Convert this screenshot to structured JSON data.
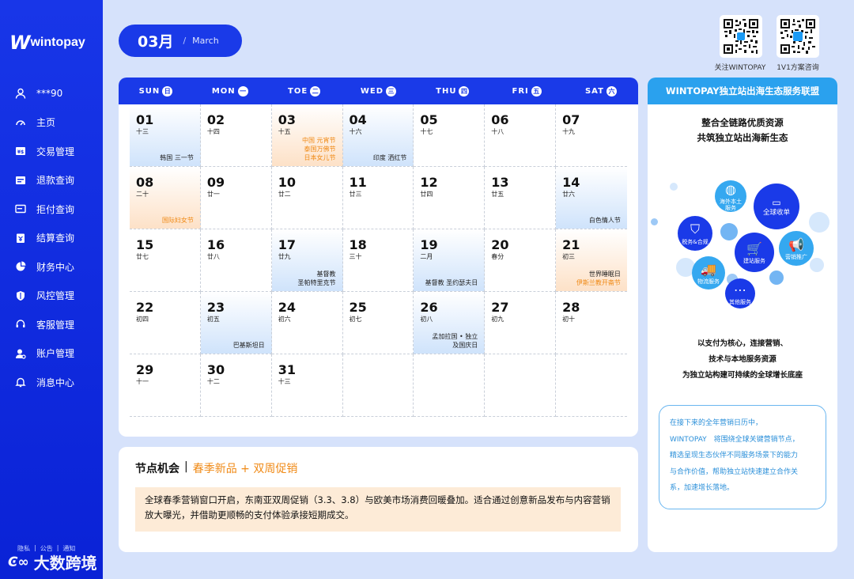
{
  "sidebar": {
    "logo_mark": "W",
    "logo_text": "wintopay",
    "user": "***90",
    "items": [
      {
        "label": "主页",
        "icon": "dashboard-icon"
      },
      {
        "label": "交易管理",
        "icon": "transaction-icon"
      },
      {
        "label": "退款查询",
        "icon": "refund-icon"
      },
      {
        "label": "拒付查询",
        "icon": "chargeback-icon"
      },
      {
        "label": "结算查询",
        "icon": "settlement-icon"
      },
      {
        "label": "财务中心",
        "icon": "pie-chart-icon"
      },
      {
        "label": "风控管理",
        "icon": "shield-icon"
      },
      {
        "label": "客服管理",
        "icon": "headset-icon"
      },
      {
        "label": "账户管理",
        "icon": "user-settings-icon"
      },
      {
        "label": "消息中心",
        "icon": "bell-icon"
      }
    ],
    "footer_links": [
      "隐私",
      "|",
      "公告",
      "|",
      "通知"
    ]
  },
  "watermark": {
    "mark": "Ͼ∞",
    "text": "大数跨境"
  },
  "header": {
    "month_num": "03月",
    "month_sep": "/",
    "month_en": "March",
    "qr_codes": [
      {
        "caption": "关注WINTOPAY"
      },
      {
        "caption": "1V1方案咨询"
      }
    ]
  },
  "calendar": {
    "weekdays": [
      {
        "label": "SUN",
        "badge": "日"
      },
      {
        "label": "MON",
        "badge": "一"
      },
      {
        "label": "TOE",
        "badge": "二"
      },
      {
        "label": "WED",
        "badge": "三"
      },
      {
        "label": "THU",
        "badge": "四"
      },
      {
        "label": "FRI",
        "badge": "五"
      },
      {
        "label": "SAT",
        "badge": "六"
      }
    ],
    "days": [
      {
        "day": "01",
        "lunar": "十三",
        "fest": "韩国 三一节",
        "style": "blue",
        "fest_color": "dark"
      },
      {
        "day": "02",
        "lunar": "十四",
        "fest": "",
        "style": "white",
        "fest_color": "dark"
      },
      {
        "day": "03",
        "lunar": "十五",
        "fest": "中国 元宵节\n泰国万佛节\n日本女儿节",
        "style": "orange",
        "fest_color": "orange"
      },
      {
        "day": "04",
        "lunar": "十六",
        "fest": "印度 洒红节",
        "style": "blue",
        "fest_color": "dark"
      },
      {
        "day": "05",
        "lunar": "十七",
        "fest": "",
        "style": "white",
        "fest_color": "dark"
      },
      {
        "day": "06",
        "lunar": "十八",
        "fest": "",
        "style": "white",
        "fest_color": "dark"
      },
      {
        "day": "07",
        "lunar": "十九",
        "fest": "",
        "style": "white",
        "fest_color": "dark"
      },
      {
        "day": "08",
        "lunar": "二十",
        "fest": "国际妇女节",
        "style": "orange",
        "fest_color": "orange"
      },
      {
        "day": "09",
        "lunar": "廿一",
        "fest": "",
        "style": "white",
        "fest_color": "dark"
      },
      {
        "day": "10",
        "lunar": "廿二",
        "fest": "",
        "style": "white",
        "fest_color": "dark"
      },
      {
        "day": "11",
        "lunar": "廿三",
        "fest": "",
        "style": "white",
        "fest_color": "dark"
      },
      {
        "day": "12",
        "lunar": "廿四",
        "fest": "",
        "style": "white",
        "fest_color": "dark"
      },
      {
        "day": "13",
        "lunar": "廿五",
        "fest": "",
        "style": "white",
        "fest_color": "dark"
      },
      {
        "day": "14",
        "lunar": "廿六",
        "fest": "白色情人节",
        "style": "blue",
        "fest_color": "dark"
      },
      {
        "day": "15",
        "lunar": "廿七",
        "fest": "",
        "style": "white",
        "fest_color": "dark"
      },
      {
        "day": "16",
        "lunar": "廿八",
        "fest": "",
        "style": "white",
        "fest_color": "dark"
      },
      {
        "day": "17",
        "lunar": "廿九",
        "fest": "基督教\n圣帕特里克节",
        "style": "blue",
        "fest_color": "dark"
      },
      {
        "day": "18",
        "lunar": "三十",
        "fest": "",
        "style": "white",
        "fest_color": "dark"
      },
      {
        "day": "19",
        "lunar": "二月",
        "fest": "基督教 圣约瑟夫日",
        "style": "blue",
        "fest_color": "dark"
      },
      {
        "day": "20",
        "lunar": "春分",
        "fest": "",
        "style": "white",
        "fest_color": "dark"
      },
      {
        "day": "21",
        "lunar": "初三",
        "fest": "世界睡眠日\n伊斯兰教开斋节",
        "style": "orange",
        "fest_color": "mixed"
      },
      {
        "day": "22",
        "lunar": "初四",
        "fest": "",
        "style": "white",
        "fest_color": "dark"
      },
      {
        "day": "23",
        "lunar": "初五",
        "fest": "巴基斯坦日",
        "style": "blue",
        "fest_color": "dark"
      },
      {
        "day": "24",
        "lunar": "初六",
        "fest": "",
        "style": "white",
        "fest_color": "dark"
      },
      {
        "day": "25",
        "lunar": "初七",
        "fest": "",
        "style": "white",
        "fest_color": "dark"
      },
      {
        "day": "26",
        "lunar": "初八",
        "fest": "孟加拉国 • 独立\n及国庆日",
        "style": "blue",
        "fest_color": "dark"
      },
      {
        "day": "27",
        "lunar": "初九",
        "fest": "",
        "style": "white",
        "fest_color": "dark"
      },
      {
        "day": "28",
        "lunar": "初十",
        "fest": "",
        "style": "white",
        "fest_color": "dark"
      },
      {
        "day": "29",
        "lunar": "十一",
        "fest": "",
        "style": "white",
        "fest_color": "dark"
      },
      {
        "day": "30",
        "lunar": "十二",
        "fest": "",
        "style": "white",
        "fest_color": "dark"
      },
      {
        "day": "31",
        "lunar": "十三",
        "fest": "",
        "style": "white",
        "fest_color": "dark"
      },
      {
        "day": "",
        "lunar": "",
        "fest": "",
        "style": "empty",
        "fest_color": "dark"
      },
      {
        "day": "",
        "lunar": "",
        "fest": "",
        "style": "empty",
        "fest_color": "dark"
      },
      {
        "day": "",
        "lunar": "",
        "fest": "",
        "style": "empty",
        "fest_color": "dark"
      },
      {
        "day": "",
        "lunar": "",
        "fest": "",
        "style": "empty",
        "fest_color": "dark"
      }
    ]
  },
  "opportunity": {
    "title": "节点机会",
    "sep": "|",
    "highlight": "春季新品 + 双周促销",
    "body": "全球春季营销窗口开启，东南亚双周促销（3.3、3.8）与欧美市场消费回暖叠加。适合通过创意新品发布与内容营销放大曝光，并借助更顺畅的支付体验承接短期成交。"
  },
  "panel": {
    "header": "WINTOPAY独立站出海生态服务联盟",
    "sub_line1": "整合全链路优质资源",
    "sub_line2": "共筑独立站出海新生态",
    "bubbles": [
      {
        "label": "海外本土\n服务",
        "icon": "globe-icon"
      },
      {
        "label": "全球收单",
        "icon": "card-icon"
      },
      {
        "label": "税务&合规",
        "icon": "tax-icon"
      },
      {
        "label": "建站服务",
        "icon": "cart-icon"
      },
      {
        "label": "营销推广",
        "icon": "megaphone-icon"
      },
      {
        "label": "物流服务",
        "icon": "truck-icon"
      },
      {
        "label": "其他服务",
        "icon": "more-icon"
      }
    ],
    "desc_line1": "以支付为核心，连接营销、",
    "desc_line2": "技术与本地服务资源",
    "desc_line3": "为独立站构建可持续的全球增长底座",
    "box_lines": [
      "在接下来的全年营销日历中，",
      "WINTOPAY　将围绕全球关键营销节点，",
      "精选呈现生态伙伴不同服务场景下的能力",
      "与合作价值，帮助独立站快速建立合作关",
      "系，加速增长落地。"
    ]
  },
  "colors": {
    "brand_blue": "#1a3ae8",
    "accent_orange": "#f08a16",
    "panel_blue": "#2aa1ee"
  }
}
